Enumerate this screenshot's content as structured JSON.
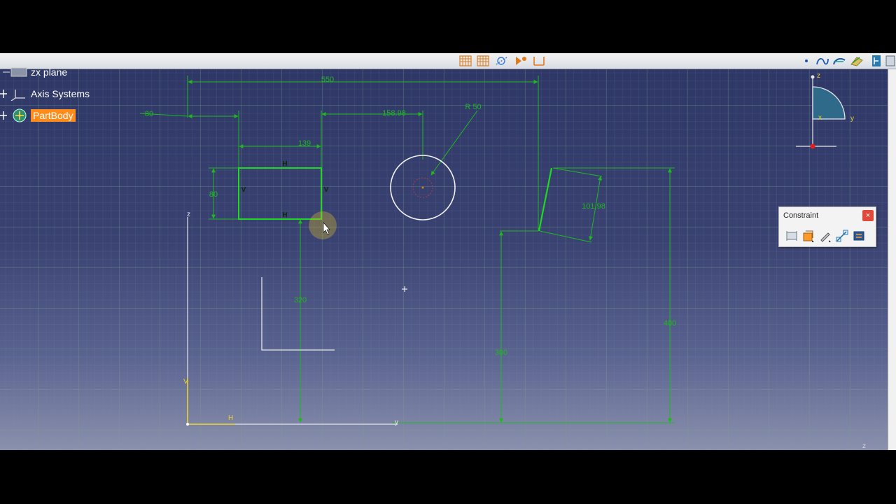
{
  "tree": {
    "items": [
      {
        "label": "zx plane"
      },
      {
        "label": "Axis Systems"
      },
      {
        "label": "PartBody",
        "selected": true
      }
    ]
  },
  "constraint_panel": {
    "title": "Constraint",
    "close": "×",
    "tools": [
      "constraint-icon",
      "contact-constraint-icon",
      "fix-together-icon",
      "auto-constraint-icon",
      "animate-constraint-icon"
    ]
  },
  "toolbar": {
    "tools": [
      "grid-icon",
      "snap-to-point-icon",
      "construction-icon",
      "geometric-constraints-icon",
      "dimensional-constraints-icon",
      "point-icon",
      "spline-icon",
      "conic-icon",
      "line-icon",
      "exit-workbench-icon"
    ]
  },
  "dimensions": {
    "total_width": "550",
    "left_offset": "80",
    "rect_width": "139",
    "rect_height": "80",
    "circle_offset": "158.98",
    "circle_radius": "R 50",
    "rect_vertical": "320",
    "slant_length": "101.98",
    "right_vertical_1": "300",
    "right_vertical_2": "400"
  },
  "constraint_marks": {
    "horizontal": "H",
    "vertical": "V"
  },
  "axes": {
    "sketch_v": "V",
    "sketch_h": "H",
    "z": "z",
    "y": "y",
    "compass_z": "z",
    "compass_y": "y",
    "compass_x": "x",
    "corner_z": "z"
  },
  "colors": {
    "dimension": "#1fb81f",
    "geometry": "#1fd81f",
    "selection": "#ff8c1a",
    "viewport_top": "#2e3766"
  }
}
